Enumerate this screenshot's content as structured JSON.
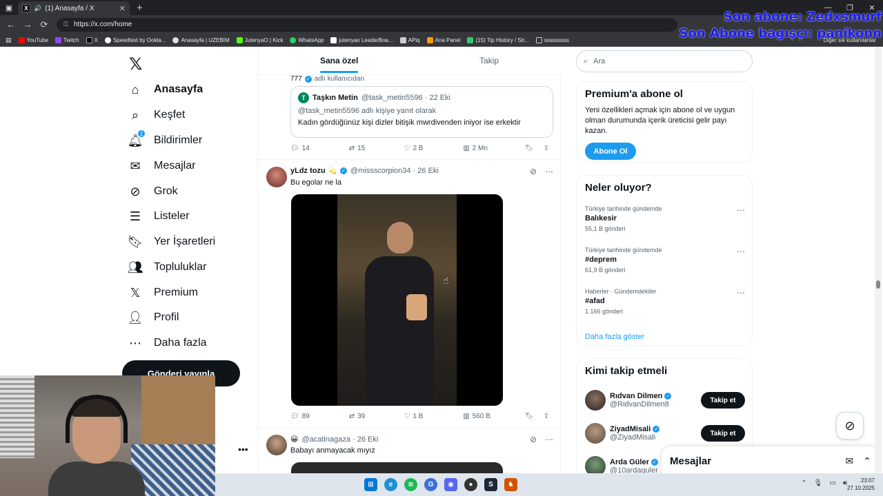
{
  "browser": {
    "tab_title": "(1) Anasayfa / X",
    "url": "https://x.com/home",
    "bookmarks": [
      "YouTube",
      "Twitch",
      "X",
      "Speedtest by Ookla...",
      "Anasayfa | UZEBIM",
      "JutenyaO | Kick",
      "WhatsApp",
      "jutenyao LeaderBoa...",
      "APiq",
      "Ana Panel",
      "(15) Tip History / Str...",
      "sssssssss"
    ],
    "other_bookmarks": "Diğer sık kullanılanlar"
  },
  "overlay": {
    "line1": "Son abone: Zedxsmurf",
    "line2": "Son Abone bagışçı: panikonn"
  },
  "leftnav": {
    "items": [
      {
        "label": "Anasayfa",
        "icon": "home-icon"
      },
      {
        "label": "Keşfet",
        "icon": "search-icon"
      },
      {
        "label": "Bildirimler",
        "icon": "bell-icon"
      },
      {
        "label": "Mesajlar",
        "icon": "mail-icon"
      },
      {
        "label": "Grok",
        "icon": "grok-icon"
      },
      {
        "label": "Listeler",
        "icon": "list-icon"
      },
      {
        "label": "Yer İşaretleri",
        "icon": "bookmark-icon"
      },
      {
        "label": "Topluluklar",
        "icon": "communities-icon"
      },
      {
        "label": "Premium",
        "icon": "x-icon"
      },
      {
        "label": "Profil",
        "icon": "profile-icon"
      },
      {
        "label": "Daha fazla",
        "icon": "more-icon"
      }
    ],
    "notif_count": "1",
    "post_button": "Gönderi yayınla"
  },
  "feed": {
    "tabs": [
      "Sana özel",
      "Takip"
    ],
    "tweet1": {
      "meta_count": "777",
      "meta_text": "adlı kullanıcıdan",
      "quote_avatar_letter": "T",
      "quote_name": "Taşkın Metin",
      "quote_handle_date": "@task_metin5596 · 22 Eki",
      "quote_reply": "@task_metin5596 adlı kişiye yanıt olarak",
      "quote_text": "Kadın gördüğünüz kişi dizler bitişik mwrdivenden iniyor ise erkektir",
      "replies": "14",
      "reposts": "15",
      "likes": "2 B",
      "views": "2 Mn"
    },
    "tweet2": {
      "name": "yLdz tozu",
      "emoji": "💫",
      "handle_date": "@missscorpion34 · 26 Eki",
      "text": "Bu egolar ne la",
      "replies": "89",
      "reposts": "39",
      "likes": "1 B",
      "views": "560 B"
    },
    "tweet3": {
      "emoji": "😀",
      "handle_date": "@acatinagaza · 26 Eki",
      "text": "Babayı anmayacak mıyız"
    }
  },
  "right": {
    "search_placeholder": "Ara",
    "premium_title": "Premium'a abone ol",
    "premium_text": "Yeni özellikleri açmak için abone ol ve uygun olman durumunda içerik üreticisi gelir payı kazan.",
    "premium_button": "Abone Ol",
    "trends_title": "Neler oluyor?",
    "trends": [
      {
        "context": "Türkiye tarihinde gündemde",
        "name": "Balıkesir",
        "count": "55,1 B gönderi"
      },
      {
        "context": "Türkiye tarihinde gündemde",
        "name": "#deprem",
        "count": "61,9 B gönderi"
      },
      {
        "context": "Haberler · Gündemdekiler",
        "name": "#afad",
        "count": "1.166 gönderi"
      }
    ],
    "show_more": "Daha fazla göster",
    "who_title": "Kimi takip etmeli",
    "who": [
      {
        "name": "Rıdvan Dilmen",
        "handle": "@RidvanDilmen8",
        "button": "Takip et"
      },
      {
        "name": "ZiyadMisali",
        "handle": "@ZiyadMisali",
        "button": "Takip et"
      },
      {
        "name": "Arda Güler",
        "handle": "@10ardaguler",
        "button": ""
      }
    ]
  },
  "dm_drawer": {
    "title": "Mesajlar"
  },
  "taskbar": {
    "time": "23:07",
    "date": "27.10.2025"
  }
}
